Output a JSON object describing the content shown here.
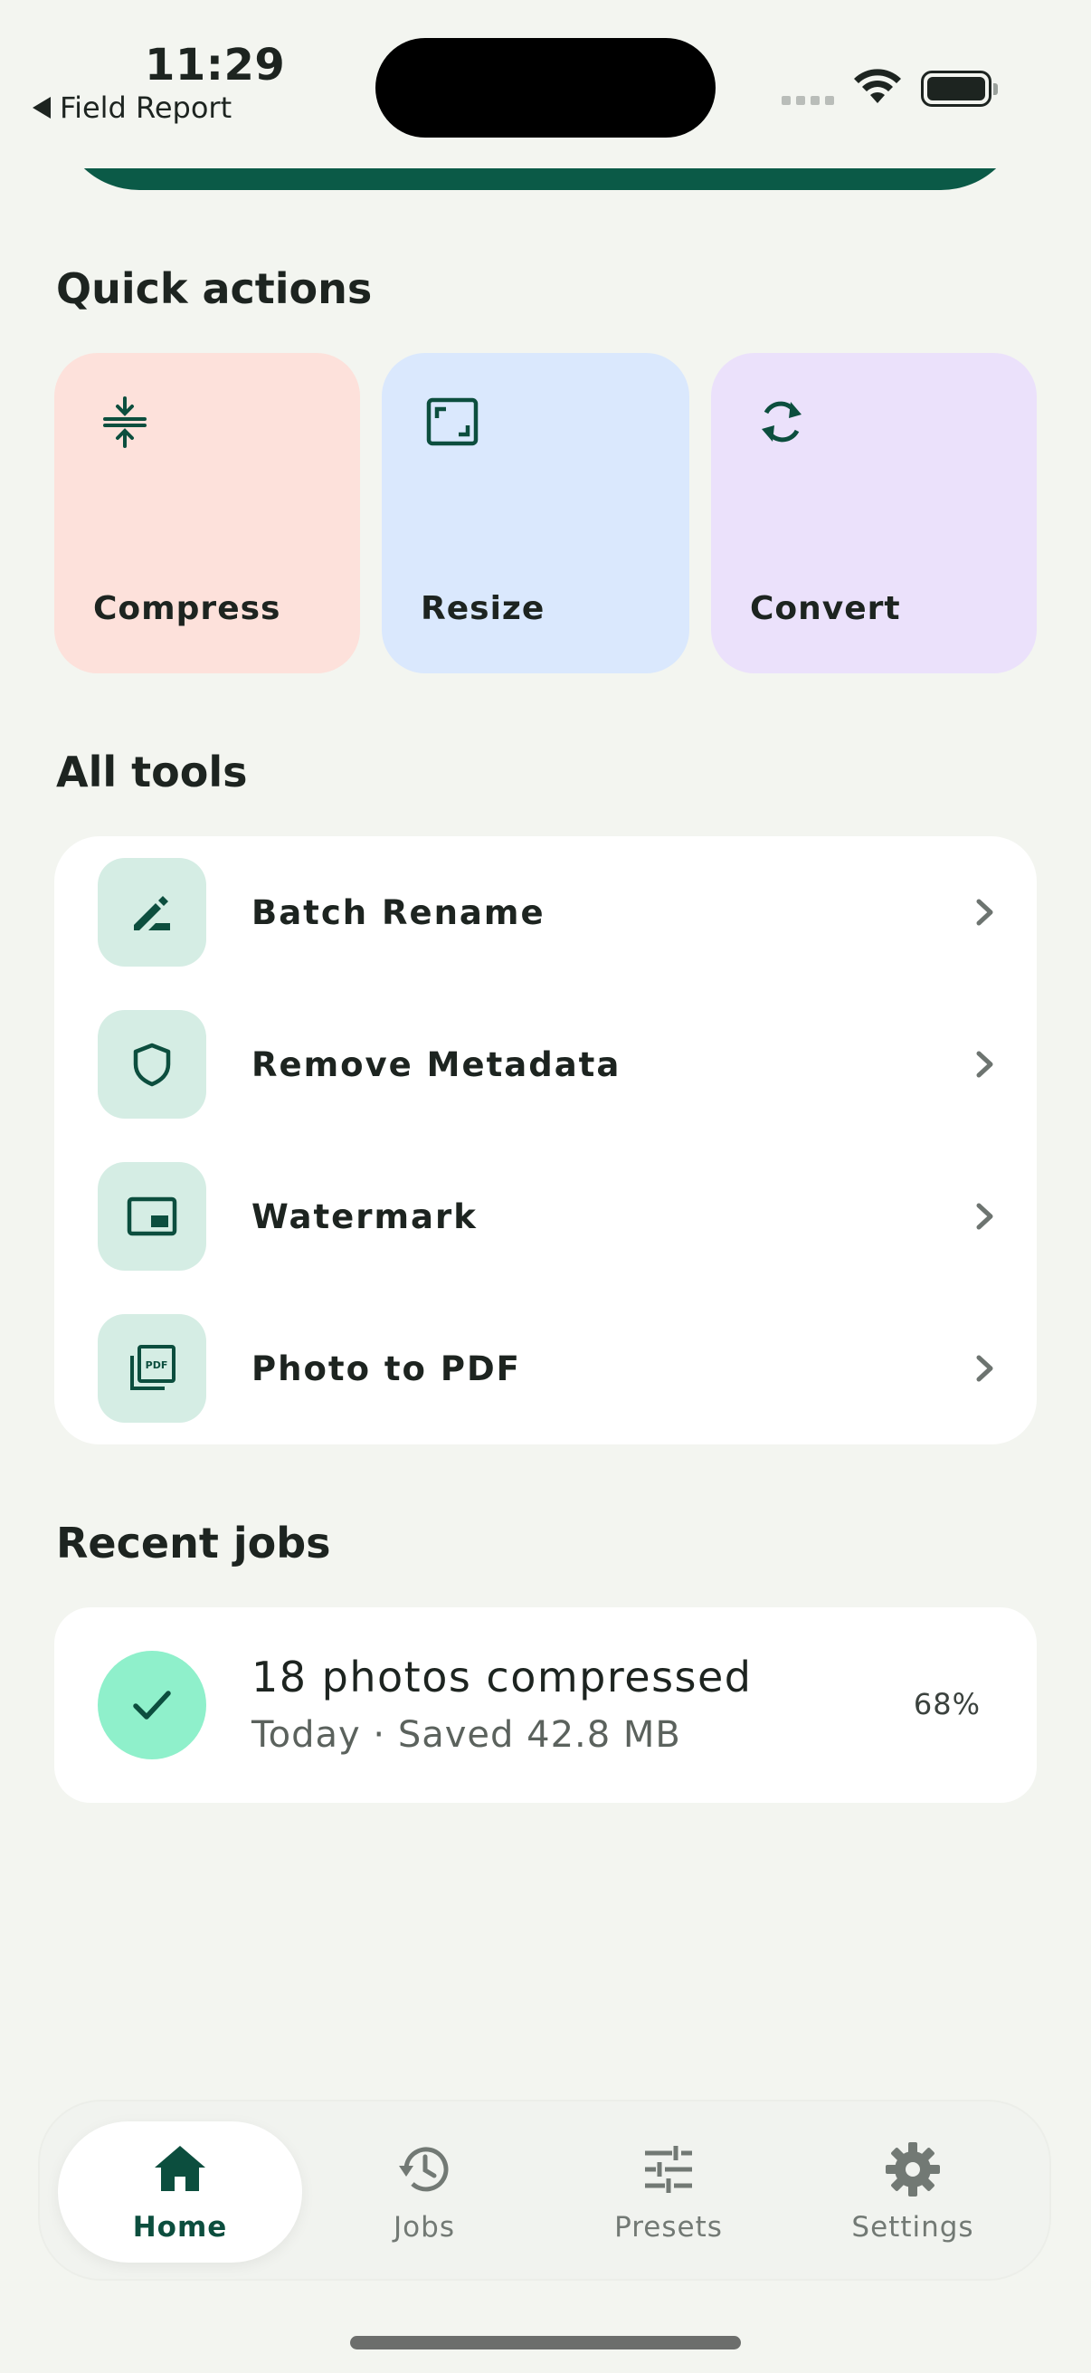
{
  "status_bar": {
    "time": "11:29",
    "back_label": "Field Report"
  },
  "quick_actions": {
    "title": "Quick actions",
    "items": [
      {
        "label": "Compress",
        "icon": "compress-icon",
        "color": "#fde1db"
      },
      {
        "label": "Resize",
        "icon": "resize-icon",
        "color": "#dae8fd"
      },
      {
        "label": "Convert",
        "icon": "convert-icon",
        "color": "#ebe1fb"
      }
    ]
  },
  "all_tools": {
    "title": "All tools",
    "items": [
      {
        "label": "Batch Rename",
        "icon": "edit-pencil-icon"
      },
      {
        "label": "Remove Metadata",
        "icon": "shield-icon"
      },
      {
        "label": "Watermark",
        "icon": "watermark-icon"
      },
      {
        "label": "Photo to PDF",
        "icon": "pdf-icon"
      }
    ]
  },
  "recent_jobs": {
    "title": "Recent jobs",
    "items": [
      {
        "title": "18 photos compressed",
        "subtitle": "Today · Saved 42.8 MB",
        "percent": "68%",
        "icon": "check-icon"
      }
    ]
  },
  "tab_bar": {
    "active": "Home",
    "tabs": [
      {
        "label": "Home",
        "icon": "home-icon"
      },
      {
        "label": "Jobs",
        "icon": "history-icon"
      },
      {
        "label": "Presets",
        "icon": "sliders-icon"
      },
      {
        "label": "Settings",
        "icon": "gear-icon"
      }
    ]
  },
  "colors": {
    "accent": "#0c4e3e",
    "background": "#f3f5f0",
    "success": "#8ff0cb"
  }
}
